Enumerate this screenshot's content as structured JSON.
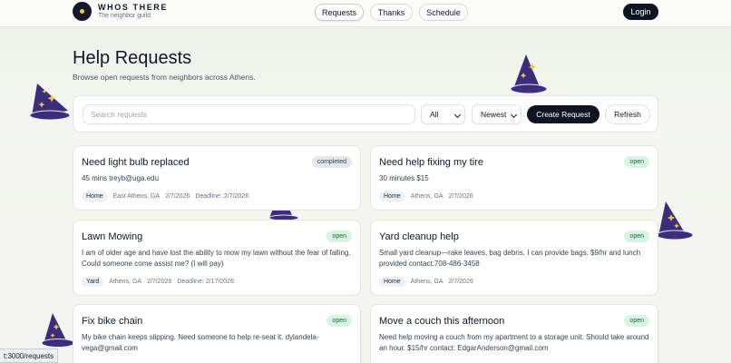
{
  "brand": {
    "title": "WHOS THERE",
    "subtitle": "The neighbor guild"
  },
  "nav": {
    "requests": "Requests",
    "thanks": "Thanks",
    "schedule": "Schedule",
    "login": "Login"
  },
  "page": {
    "title": "Help Requests",
    "subtitle": "Browse open requests from neighbors across Athens."
  },
  "toolbar": {
    "search_placeholder": "Search requests",
    "status_filter": "All",
    "sort": "Newest",
    "create_label": "Create Request",
    "refresh_label": "Refresh"
  },
  "cards": [
    {
      "title": "Need light bulb replaced",
      "status": "completed",
      "desc": "45 mins treyb@uga.edu",
      "tag": "Home",
      "location": "East Athens, GA",
      "date": "2/7/2026",
      "deadline": "Deadline: 2/7/2026"
    },
    {
      "title": "Need help fixing my tire",
      "status": "open",
      "desc": "30 minutes $15",
      "tag": "Home",
      "location": "Athens, GA",
      "date": "2/7/2026"
    },
    {
      "title": "Lawn Mowing",
      "status": "open",
      "desc": "I am of older age and have lost the ability to mow my lawn without the fear of falling. Could someone come assist me? (I will pay)",
      "tag": "Yard",
      "location": "Athens, GA",
      "date": "2/7/2026",
      "deadline": "Deadline: 2/17/2026"
    },
    {
      "title": "Yard cleanup help",
      "status": "open",
      "desc": "Small yard cleanup—rake leaves, bag debris. I can provide bags. $9/hr and lunch provided contact:708-486-3458",
      "tag": "Home",
      "location": "Athens, GA",
      "date": "2/7/2026"
    },
    {
      "title": "Fix bike chain",
      "status": "open",
      "desc": "My bike chain keeps slipping. Need someone to help re-seat it. dylandela-vega@gmail.com"
    },
    {
      "title": "Move a couch this afternoon",
      "status": "open",
      "desc": "Need help moving a couch from my apartment to a storage unit. Should take around an hour. $15/hr contact: EdgarAnderson@gmail.com"
    }
  ],
  "status_bar": {
    "url": "t:3000/requests"
  },
  "colors": {
    "primary_dark": "#0f1422",
    "open_badge_bg": "#d9f4e3",
    "open_badge_text": "#17663a",
    "hat_purple": "#3b2d7a",
    "star_gold": "#f2c94c"
  },
  "icons": [
    "wizard-hat-icon",
    "chevron-down-icon",
    "logo-icon"
  ]
}
